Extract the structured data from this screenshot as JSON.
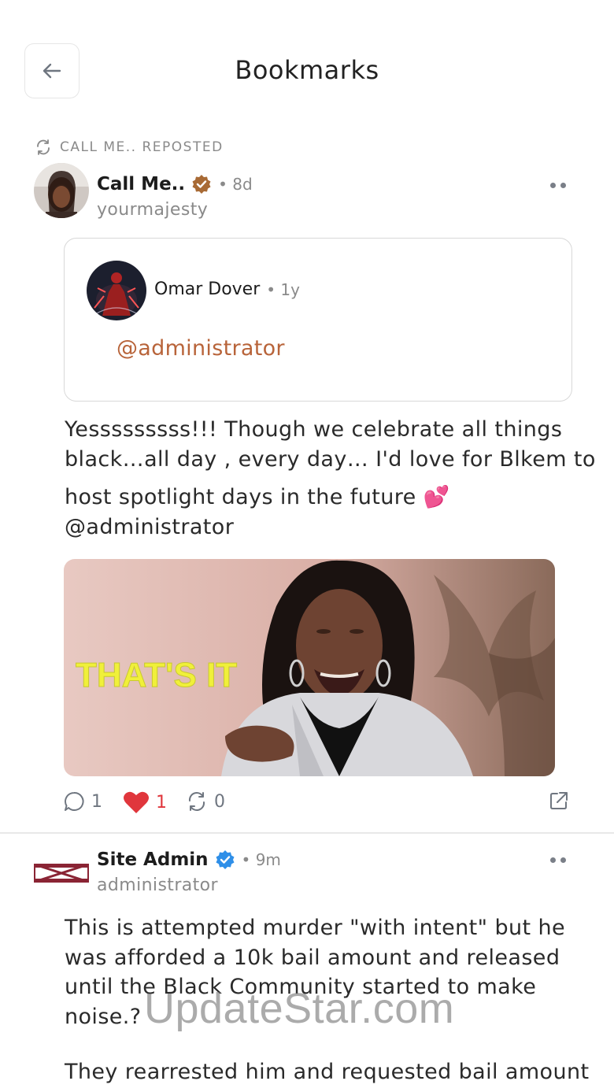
{
  "header": {
    "title": "Bookmarks"
  },
  "post1": {
    "repost_label": "CALL ME.. REPOSTED",
    "author": {
      "name": "Call Me..",
      "time": "• 8d",
      "handle": "yourmajesty",
      "badge_color": "#a86a35"
    },
    "quote": {
      "author_name": "Omar Dover",
      "time": "• 1y",
      "mention": "@administrator"
    },
    "text_lines": [
      "Yesssssssss!!! Though we celebrate all things",
      "black…all day , every day… I'd love for Blkem to",
      "host spotlight days in the future 💕",
      "@administrator"
    ],
    "gif_caption": "THAT'S IT",
    "actions": {
      "comments": "1",
      "likes": "1",
      "reposts": "0"
    }
  },
  "post2": {
    "author": {
      "name": "Site Admin",
      "time": "• 9m",
      "handle": "administrator",
      "badge_color": "#2f8fe8"
    },
    "text_lines": [
      "This is attempted murder \"with intent\" but he",
      "was afforded a 10k bail amount and released",
      "until the Black Community started to make",
      "noise.?"
    ],
    "text_lines_2": [
      "They rearrested him and requested bail amount"
    ]
  },
  "watermark": "UpdateStar.com",
  "colors": {
    "accent": "#b8643a",
    "like": "#e0363c",
    "verified": "#2f8fe8"
  }
}
